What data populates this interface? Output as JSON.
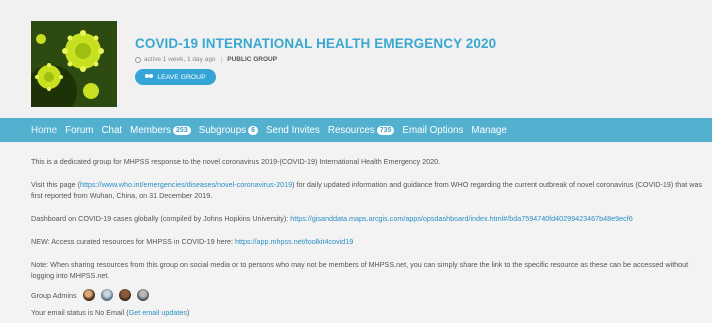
{
  "group": {
    "title": "COVID-19 INTERNATIONAL HEALTH EMERGENCY 2020",
    "activity": "active 1 week, 1 day ago",
    "type": "PUBLIC GROUP",
    "leave_label": "LEAVE GROUP"
  },
  "nav": {
    "items": [
      {
        "label": "Home",
        "count": null
      },
      {
        "label": "Forum",
        "count": null
      },
      {
        "label": "Chat",
        "count": null
      },
      {
        "label": "Members",
        "count": "253"
      },
      {
        "label": "Subgroups",
        "count": "6"
      },
      {
        "label": "Send Invites",
        "count": null
      },
      {
        "label": "Resources",
        "count": "735"
      },
      {
        "label": "Email Options",
        "count": null
      },
      {
        "label": "Manage",
        "count": null
      }
    ]
  },
  "content": {
    "intro": "This is a dedicated group for MHPSS response to the novel coronavirus 2019-(COVID-19) International Health Emergency 2020.",
    "visit_prefix": "Visit this page (",
    "visit_link": "https://www.who.int/emergencies/diseases/novel-coronavirus-2019",
    "visit_suffix": ") for daily updated information and guidance from WHO regarding the current outbreak of novel coronavirus (COVID-19) that was first reported from Wuhan, China, on 31 December 2019.",
    "dashboard_prefix": "Dashboard on COVID-19 cases globally (compiled by Johns Hopkins University): ",
    "dashboard_link": "https://gisanddata.maps.arcgis.com/apps/opsdashboard/index.html#/bda7594740fd40299423467b48e9ecf6",
    "new_prefix": "NEW: Access curated resources for MHPSS in COVID-19 here: ",
    "new_link": "https://app.mhpss.net/toolkit4covid19",
    "note": "Note: When sharing resources from this group on social media or to persons who may not be members of MHPSS.net, you can simply share the link to the specific resource as these can be accessed without logging into MHPSS.net.",
    "admins_label": "Group Admins",
    "email_prefix": "Your email status is No Email (",
    "email_link": "Get email updates",
    "email_suffix": ")"
  },
  "colors": {
    "title": "#3aa8d1",
    "nav_bg": "#53b1cf",
    "button": "#35a4d6",
    "link": "#2a8fc4"
  }
}
